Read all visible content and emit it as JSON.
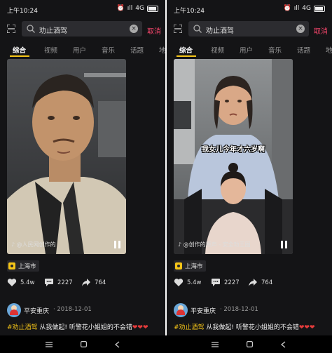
{
  "status": {
    "time": "上午10:24",
    "signal": "4G"
  },
  "search": {
    "query": "劝止酒驾",
    "cancel_label": "取消"
  },
  "tabs": [
    {
      "label": "综合",
      "active": true
    },
    {
      "label": "视频"
    },
    {
      "label": "用户"
    },
    {
      "label": "音乐"
    },
    {
      "label": "话题"
    },
    {
      "label": "地"
    }
  ],
  "accent": "#f5c518",
  "cancel_color": "#f2456a",
  "left_card": {
    "music_text": "@人民网创作的",
    "location": "上海市",
    "likes": "5.4w",
    "comments": "2227",
    "shares": "764",
    "author": "平安重庆",
    "date": "· 2018-12-01",
    "hashtag": "#劝止酒驾",
    "description": " 从我做起! 听警花小姐姐的不会错",
    "hearts": "❤❤❤"
  },
  "right_card": {
    "subtitle": "我女儿今年才六岁啊",
    "music_text": "@创作的原声 - 安全劝王图",
    "location": "上海市",
    "likes": "5.4w",
    "comments": "2227",
    "shares": "764",
    "author": "平安重庆",
    "date": "· 2018-12-01",
    "hashtag": "#劝止酒驾",
    "description": " 从我做起! 听警花小姐姐的不会错",
    "hearts": "❤❤❤"
  },
  "navbar": {
    "icons": [
      "menu-icon",
      "home-square-icon",
      "back-icon"
    ]
  }
}
